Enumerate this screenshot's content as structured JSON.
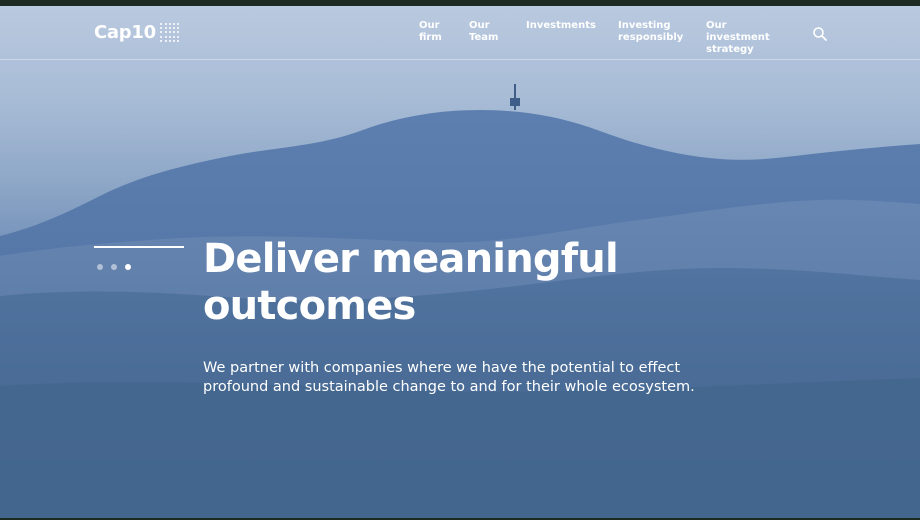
{
  "header": {
    "logo_text": "Cap10",
    "nav": [
      {
        "label": "Our\nfirm"
      },
      {
        "label": "Our\nTeam"
      },
      {
        "label": "Investments"
      },
      {
        "label": "Investing\nresponsibly"
      },
      {
        "label": "Our investment\nstrategy"
      }
    ],
    "search_icon": "search-icon"
  },
  "hero": {
    "headline": "Deliver meaningful outcomes",
    "subtext": "We partner with companies where we have the potential to effect profound and sustainable change to and for their whole ecosystem.",
    "slides": [
      {
        "active": false
      },
      {
        "active": false
      },
      {
        "active": true
      }
    ]
  },
  "colors": {
    "sky_top": "#b9c9df",
    "mountain_blue": "#44668f",
    "text": "#ffffff"
  }
}
